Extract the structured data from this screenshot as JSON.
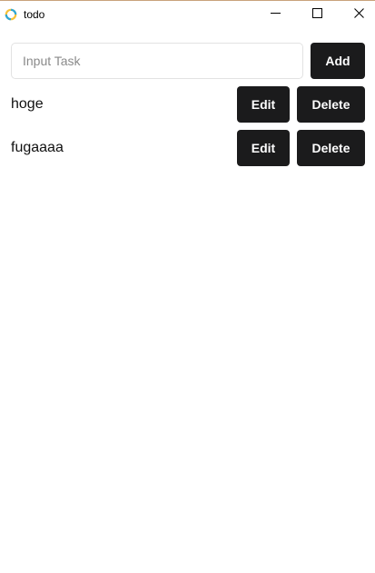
{
  "window": {
    "title": "todo",
    "controls": [
      "minimize-icon",
      "maximize-icon",
      "close-icon"
    ]
  },
  "input": {
    "value": "",
    "placeholder": "Input Task"
  },
  "add_label": "Add",
  "tasks": [
    {
      "label": "hoge",
      "edit_label": "Edit",
      "delete_label": "Delete"
    },
    {
      "label": "fugaaaa",
      "edit_label": "Edit",
      "delete_label": "Delete"
    }
  ],
  "colors": {
    "button_bg": "#1b1b1c",
    "button_text": "#ffffff",
    "input_border": "#e2e2e2",
    "placeholder": "#8a8a8a"
  }
}
